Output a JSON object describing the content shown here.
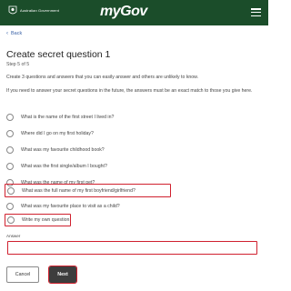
{
  "header": {
    "gov_name": "Australian Government",
    "logo_my": "my",
    "logo_gov": "Gov",
    "menu_icon": "hamburger-menu-icon",
    "background": "#1b4d2a"
  },
  "nav": {
    "back_label": "Back"
  },
  "page": {
    "title": "Create secret question 1",
    "step": "Step 5 of 5",
    "intro": "Create 3 questions and answers that you can easily answer and others are unlikely to know.",
    "intro2": "If you need to answer your secret questions in the future, the answers must be an exact match to those you give here."
  },
  "options": [
    {
      "label": "What is the name of the first street I lived in?"
    },
    {
      "label": "Where did I go on my first holiday?"
    },
    {
      "label": "What was my favourite childhood book?"
    },
    {
      "label": "What was the first single/album I bought?"
    },
    {
      "label": "What was the name of my first pet?"
    },
    {
      "label": "What was the full name of my first boyfriend/girlfriend?"
    },
    {
      "label": "What was my favourite place to visit as a child?"
    },
    {
      "label": "Write my own question"
    }
  ],
  "answer": {
    "label": "Answer",
    "value": ""
  },
  "buttons": {
    "cancel": "Cancel",
    "next": "Next"
  },
  "colors": {
    "highlight": "#d0202e",
    "link": "#3a62a7",
    "primary_button": "#3d3d3d"
  }
}
